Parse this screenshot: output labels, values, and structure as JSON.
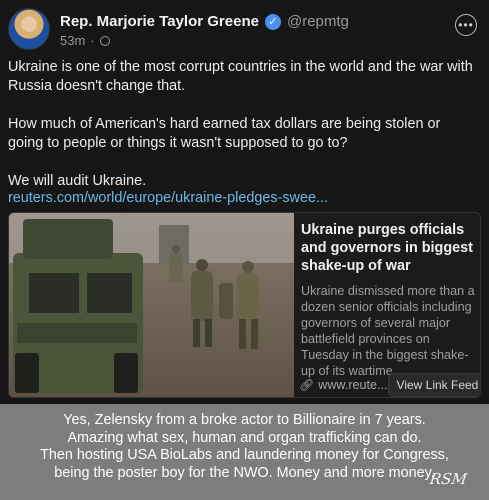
{
  "post": {
    "author_name": "Rep. Marjorie Taylor Greene",
    "handle": "@repmtg",
    "timestamp": "53m",
    "dot": "·",
    "verified_icon": "verified-badge-icon",
    "more_icon": "more-options-icon",
    "paragraphs": [
      "Ukraine is one of the most corrupt countries in the world and the war with Russia doesn't change that.",
      "How much of American's hard earned tax dollars are being stolen or going to people or things it wasn't supposed to go to?",
      "We will audit Ukraine."
    ],
    "link_text": "reuters.com/world/europe/ukraine-pledges-swee..."
  },
  "card": {
    "title": "Ukraine purges officials and governors in biggest shake-up of war",
    "description": "Ukraine dismissed more than a dozen senior officials including governors of several major battlefield provinces on Tuesday in the biggest shake-up of its wartime...",
    "domain": "www.reute...",
    "view_button": "View Link Feed"
  },
  "caption": {
    "lines": [
      "Yes, Zelensky from a broke actor to Billionaire in 7 years.",
      "Amazing what sex, human and organ trafficking can do.",
      "Then hosting USA BioLabs and laundering money for Congress,",
      "being the poster boy for the NWO. Money and more money."
    ],
    "signature": "RSM"
  },
  "colors": {
    "link": "#6cb8e6",
    "verified": "#4a90f5",
    "caption_bg": "#7d7d7d",
    "background": "#161616"
  }
}
